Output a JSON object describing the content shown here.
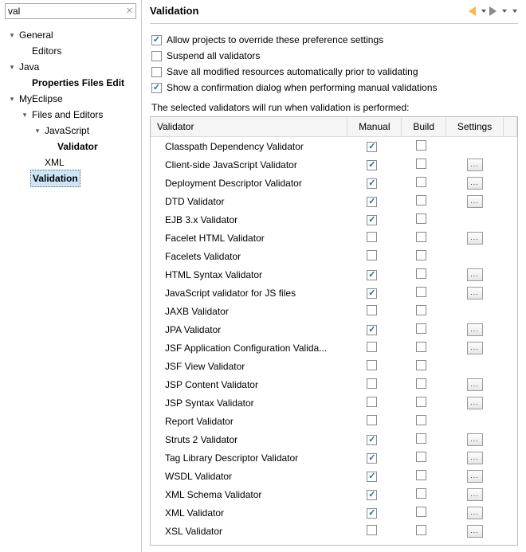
{
  "search": {
    "value": "val",
    "clear": "✕"
  },
  "tree": [
    {
      "depth": 0,
      "tw": "▾",
      "label": "General"
    },
    {
      "depth": 1,
      "tw": "",
      "label": "Editors"
    },
    {
      "depth": 0,
      "tw": "▾",
      "label": "Java"
    },
    {
      "depth": 1,
      "tw": "",
      "label": "Properties Files Edit",
      "bold": true
    },
    {
      "depth": 0,
      "tw": "▾",
      "label": "MyEclipse"
    },
    {
      "depth": 1,
      "tw": "▾",
      "label": "Files and Editors"
    },
    {
      "depth": 2,
      "tw": "▾",
      "label": "JavaScript"
    },
    {
      "depth": 3,
      "tw": "",
      "label": "Validator",
      "bold": true
    },
    {
      "depth": 2,
      "tw": "",
      "label": "XML"
    },
    {
      "depth": 1,
      "tw": "",
      "label": "Validation",
      "bold": true,
      "selected": true
    }
  ],
  "header": {
    "title": "Validation"
  },
  "options": [
    {
      "label": "Allow projects to override these preference settings",
      "checked": true
    },
    {
      "label": "Suspend all validators",
      "checked": false
    },
    {
      "label": "Save all modified resources automatically prior to validating",
      "checked": false
    },
    {
      "label": "Show a confirmation dialog when performing manual validations",
      "checked": true
    }
  ],
  "hint": "The selected validators will run when validation is performed:",
  "cols": {
    "validator": "Validator",
    "manual": "Manual",
    "build": "Build",
    "settings": "Settings"
  },
  "settings_label": "...",
  "rows": [
    {
      "name": "Classpath Dependency Validator",
      "manual": true,
      "build": false,
      "settings": false
    },
    {
      "name": "Client-side JavaScript Validator",
      "manual": true,
      "build": false,
      "settings": true
    },
    {
      "name": "Deployment Descriptor Validator",
      "manual": true,
      "build": false,
      "settings": true
    },
    {
      "name": "DTD Validator",
      "manual": true,
      "build": false,
      "settings": true
    },
    {
      "name": "EJB 3.x Validator",
      "manual": true,
      "build": false,
      "settings": false
    },
    {
      "name": "Facelet HTML Validator",
      "manual": false,
      "build": false,
      "settings": true
    },
    {
      "name": "Facelets Validator",
      "manual": false,
      "build": false,
      "settings": false
    },
    {
      "name": "HTML Syntax Validator",
      "manual": true,
      "build": false,
      "settings": true
    },
    {
      "name": "JavaScript validator for JS files",
      "manual": true,
      "build": false,
      "settings": true
    },
    {
      "name": "JAXB Validator",
      "manual": false,
      "build": false,
      "settings": false
    },
    {
      "name": "JPA Validator",
      "manual": true,
      "build": false,
      "settings": true
    },
    {
      "name": "JSF Application Configuration Valida...",
      "manual": false,
      "build": false,
      "settings": true
    },
    {
      "name": "JSF View Validator",
      "manual": false,
      "build": false,
      "settings": false
    },
    {
      "name": "JSP Content Validator",
      "manual": false,
      "build": false,
      "settings": true
    },
    {
      "name": "JSP Syntax Validator",
      "manual": false,
      "build": false,
      "settings": true
    },
    {
      "name": "Report Validator",
      "manual": false,
      "build": false,
      "settings": false
    },
    {
      "name": "Struts 2 Validator",
      "manual": true,
      "build": false,
      "settings": true
    },
    {
      "name": "Tag Library Descriptor Validator",
      "manual": true,
      "build": false,
      "settings": true
    },
    {
      "name": "WSDL Validator",
      "manual": true,
      "build": false,
      "settings": true
    },
    {
      "name": "XML Schema Validator",
      "manual": true,
      "build": false,
      "settings": true
    },
    {
      "name": "XML Validator",
      "manual": true,
      "build": false,
      "settings": true
    },
    {
      "name": "XSL Validator",
      "manual": false,
      "build": false,
      "settings": true
    }
  ]
}
